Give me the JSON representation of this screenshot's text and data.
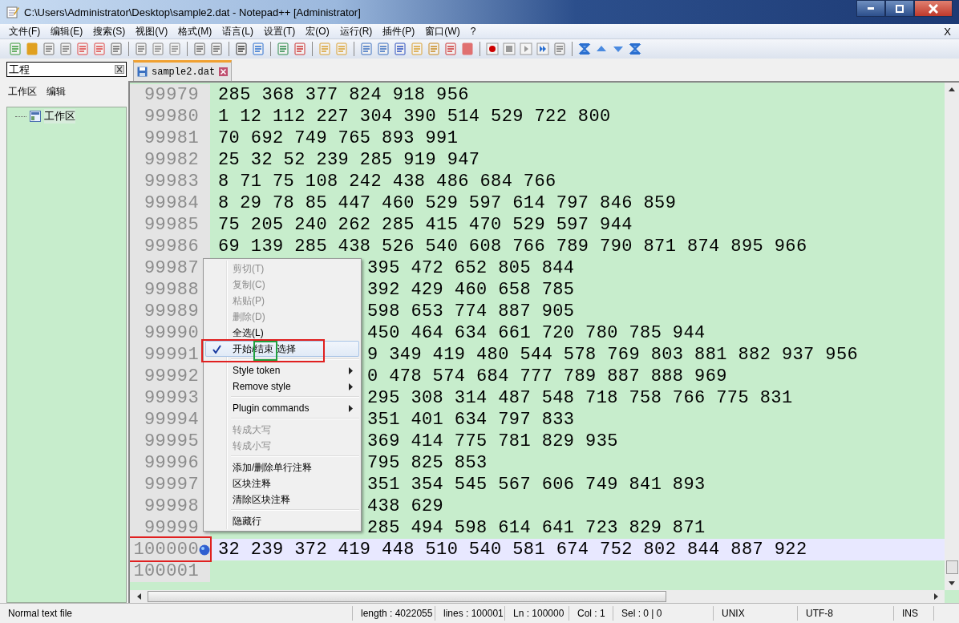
{
  "window": {
    "title": "C:\\Users\\Administrator\\Desktop\\sample2.dat - Notepad++ [Administrator]"
  },
  "menu_bar": [
    "文件(F)",
    "编辑(E)",
    "搜索(S)",
    "视图(V)",
    "格式(M)",
    "语言(L)",
    "设置(T)",
    "宏(O)",
    "运行(R)",
    "插件(P)",
    "窗口(W)",
    "?"
  ],
  "menu_close": "X",
  "project_panel": {
    "title": "工程",
    "menus": [
      "工作区",
      "编辑"
    ],
    "tree": [
      {
        "label": "工作区"
      }
    ]
  },
  "tabs": [
    {
      "label": "sample2.dat",
      "selected": true
    }
  ],
  "lines": [
    {
      "number": "99979",
      "text": "285 368 377 824 918 956",
      "kind": "full",
      "current": false,
      "bookmark": false
    },
    {
      "number": "99980",
      "text": "1 12 112 227 304 390 514 529 722 800",
      "kind": "full",
      "current": false,
      "bookmark": false
    },
    {
      "number": "99981",
      "text": "70 692 749 765 893 991",
      "kind": "full",
      "current": false,
      "bookmark": false
    },
    {
      "number": "99982",
      "text": "25 32 52 239 285 919 947",
      "kind": "full",
      "current": false,
      "bookmark": false
    },
    {
      "number": "99983",
      "text": "8 71 75 108 242 438 486 684 766",
      "kind": "full",
      "current": false,
      "bookmark": false
    },
    {
      "number": "99984",
      "text": "8 29 78 85 447 460 529 597 614 797 846 859",
      "kind": "full",
      "current": false,
      "bookmark": false
    },
    {
      "number": "99985",
      "text": "75 205 240 262 285 415 470 529 597 944",
      "kind": "full",
      "current": false,
      "bookmark": false
    },
    {
      "number": "99986",
      "text": "69 139 285 438 526 540 608 766 789 790 871 874 895 966",
      "kind": "full",
      "current": false,
      "bookmark": false
    },
    {
      "number": "99987",
      "text": "395 472 652 805 844",
      "kind": "partial",
      "current": false,
      "bookmark": false
    },
    {
      "number": "99988",
      "text": "392 429 460 658 785",
      "kind": "partial",
      "current": false,
      "bookmark": false
    },
    {
      "number": "99989",
      "text": "598 653 774 887 905",
      "kind": "partial",
      "current": false,
      "bookmark": false
    },
    {
      "number": "99990",
      "text": "450 464 634 661 720 780 785 944",
      "kind": "partial",
      "current": false,
      "bookmark": false
    },
    {
      "number": "99991",
      "text": "9 349 419 480 544 578 769 803 881 882 937 956",
      "kind": "partial",
      "current": false,
      "bookmark": false
    },
    {
      "number": "99992",
      "text": "0 478 574 684 777 789 887 888 969",
      "kind": "partial",
      "current": false,
      "bookmark": false
    },
    {
      "number": "99993",
      "text": "295 308 314 487 548 718 758 766 775 831",
      "kind": "partial",
      "current": false,
      "bookmark": false
    },
    {
      "number": "99994",
      "text": "351 401 634 797 833",
      "kind": "partial",
      "current": false,
      "bookmark": false
    },
    {
      "number": "99995",
      "text": "369 414 775 781 829 935",
      "kind": "partial",
      "current": false,
      "bookmark": false
    },
    {
      "number": "99996",
      "text": "795 825 853",
      "kind": "partial",
      "current": false,
      "bookmark": false
    },
    {
      "number": "99997",
      "text": "351 354 545 567 606 749 841 893",
      "kind": "partial",
      "current": false,
      "bookmark": false
    },
    {
      "number": "99998",
      "text": "438 629",
      "kind": "partial",
      "current": false,
      "bookmark": false
    },
    {
      "number": "99999",
      "text": "285 494 598 614 641 723 829 871",
      "kind": "partial",
      "current": false,
      "bookmark": false
    },
    {
      "number": "100000",
      "text": "32 239 372 419 448 510 540 581 674 752 802 844 887 922",
      "kind": "full",
      "current": true,
      "bookmark": true
    },
    {
      "number": "100001",
      "kind": "full",
      "current": false,
      "bookmark": false
    }
  ],
  "context_menu": [
    {
      "kind": "item",
      "label": "剪切(T)",
      "disabled": true,
      "checked": false,
      "selected": false,
      "submenu": false
    },
    {
      "kind": "item",
      "label": "复制(C)",
      "disabled": true,
      "checked": false,
      "selected": false,
      "submenu": false
    },
    {
      "kind": "item",
      "label": "粘贴(P)",
      "disabled": true,
      "checked": false,
      "selected": false,
      "submenu": false
    },
    {
      "kind": "item",
      "label": "删除(D)",
      "disabled": true,
      "checked": false,
      "selected": false,
      "submenu": false
    },
    {
      "kind": "item",
      "label": "全选(L)",
      "disabled": false,
      "checked": false,
      "selected": false,
      "submenu": false
    },
    {
      "kind": "item",
      "label": "开始/结束 选择",
      "disabled": false,
      "checked": true,
      "selected": true,
      "submenu": false
    },
    {
      "kind": "separator"
    },
    {
      "kind": "item",
      "label": "Style token",
      "disabled": false,
      "checked": false,
      "selected": false,
      "submenu": true
    },
    {
      "kind": "item",
      "label": "Remove style",
      "disabled": false,
      "checked": false,
      "selected": false,
      "submenu": true
    },
    {
      "kind": "separator"
    },
    {
      "kind": "item",
      "label": "Plugin commands",
      "disabled": false,
      "checked": false,
      "selected": false,
      "submenu": true
    },
    {
      "kind": "separator"
    },
    {
      "kind": "item",
      "label": "转成大写",
      "disabled": true,
      "checked": false,
      "selected": false,
      "submenu": false
    },
    {
      "kind": "item",
      "label": "转成小写",
      "disabled": true,
      "checked": false,
      "selected": false,
      "submenu": false
    },
    {
      "kind": "separator"
    },
    {
      "kind": "item",
      "label": "添加/删除单行注释",
      "disabled": false,
      "checked": false,
      "selected": false,
      "submenu": false
    },
    {
      "kind": "item",
      "label": "区块注释",
      "disabled": false,
      "checked": false,
      "selected": false,
      "submenu": false
    },
    {
      "kind": "item",
      "label": "清除区块注释",
      "disabled": false,
      "checked": false,
      "selected": false,
      "submenu": false
    },
    {
      "kind": "separator"
    },
    {
      "kind": "item",
      "label": "隐藏行",
      "disabled": false,
      "checked": false,
      "selected": false,
      "submenu": false
    }
  ],
  "status_bar": [
    "Normal text file",
    "length : 4022055",
    "lines : 100001",
    "Ln : 100000",
    "Col : 1",
    "Sel : 0 | 0",
    "UNIX",
    "UTF-8",
    "INS"
  ]
}
